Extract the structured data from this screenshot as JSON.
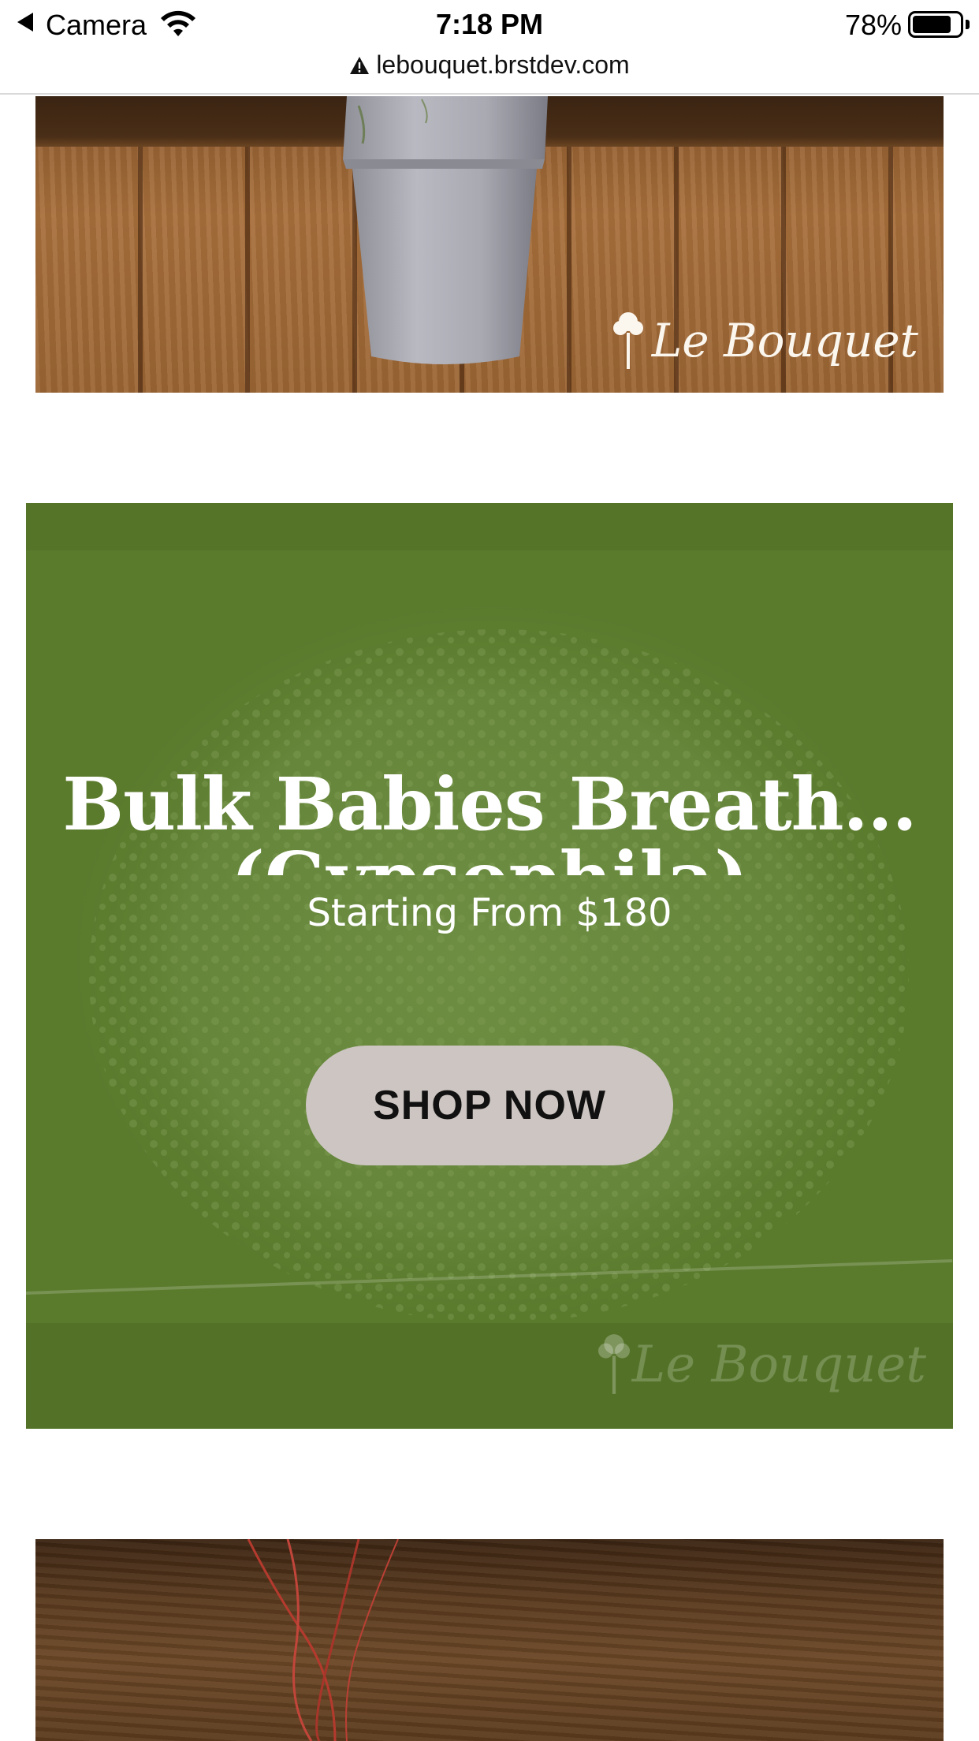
{
  "status_bar": {
    "back_label": "Camera",
    "time": "7:18 PM",
    "battery_percent": "78%",
    "battery_level": 0.78
  },
  "browser": {
    "url": "lebouquet.brstdev.com",
    "security_icon": "warning-triangle-icon"
  },
  "product_top": {
    "watermark": "Le Bouquet"
  },
  "promo": {
    "title": "Bulk Babies Breath...",
    "title_overflow": "(Gypsophila)",
    "price": "Starting From $180",
    "button_label": "SHOP NOW",
    "watermark": "Le Bouquet",
    "colors": {
      "background": "#5a7a2c",
      "button": "#ccc5c1"
    }
  }
}
